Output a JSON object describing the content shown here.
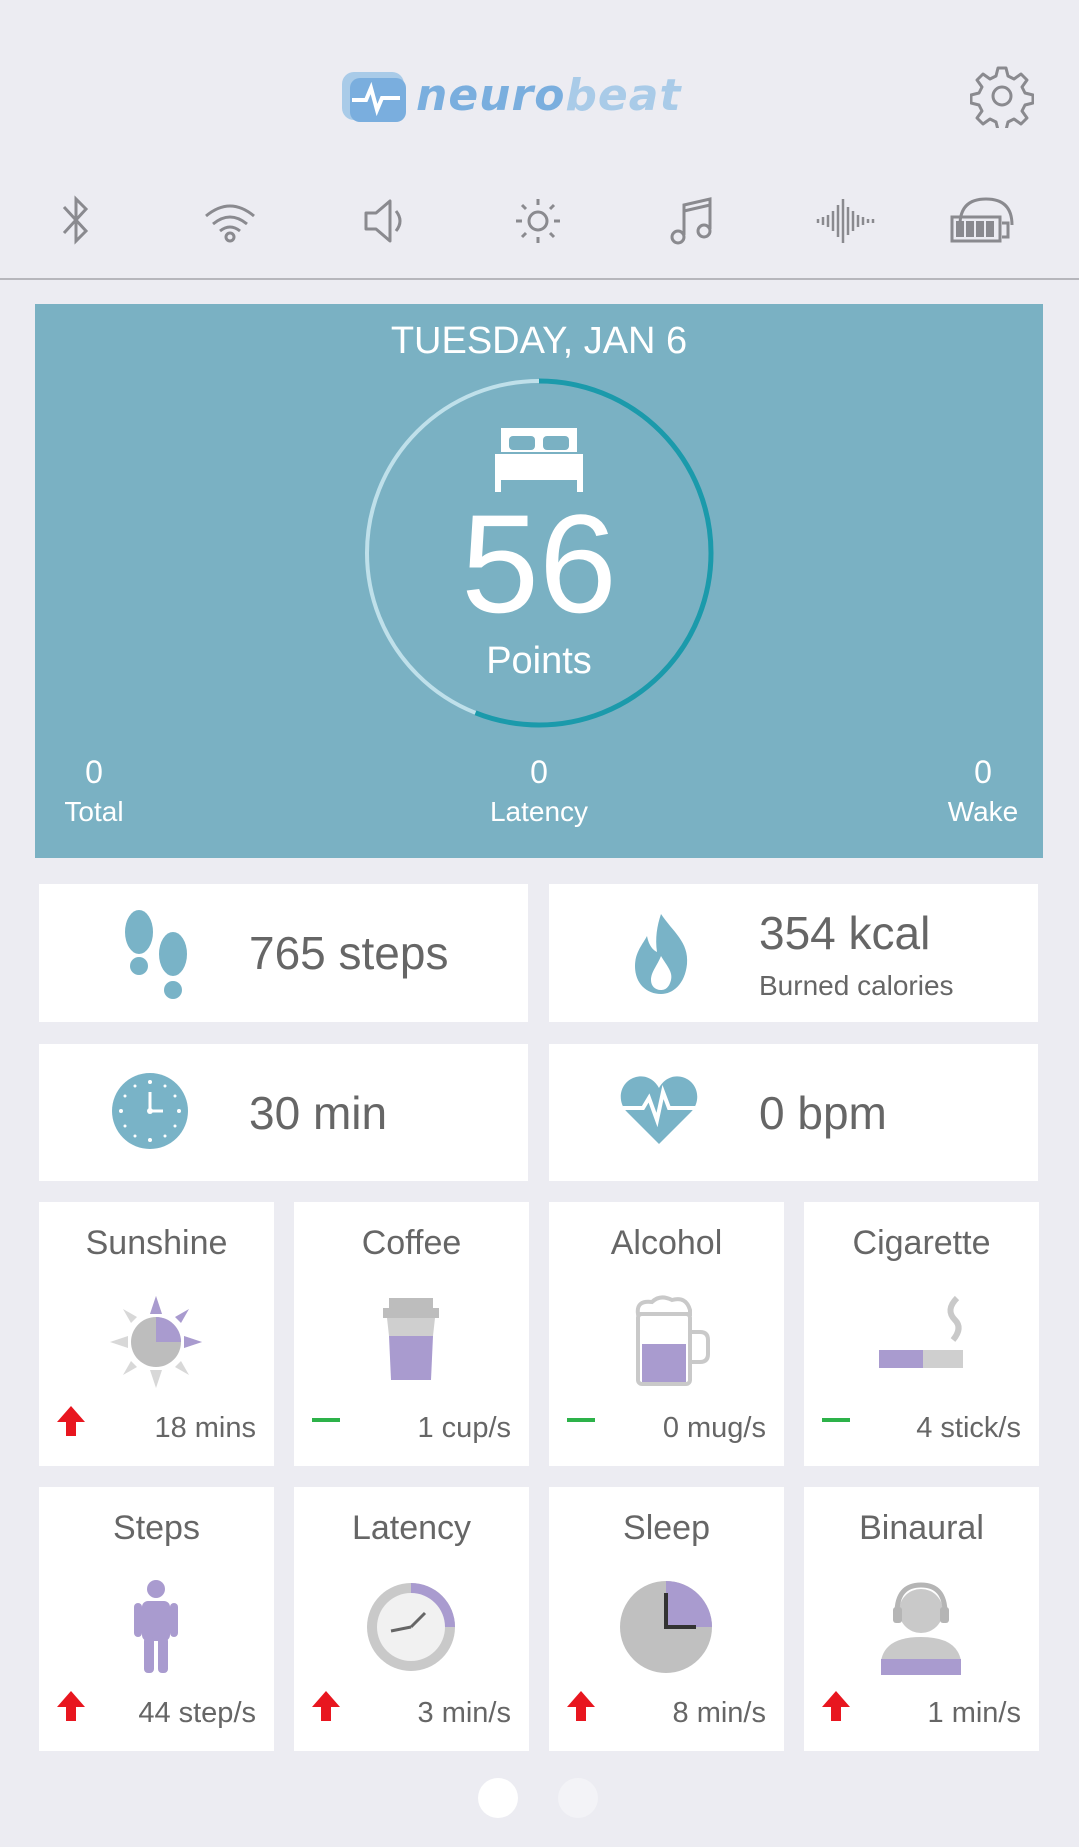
{
  "header": {
    "logo_part_a": "neuro",
    "logo_part_b": "beat",
    "status_icons": [
      "bluetooth-icon",
      "wifi-icon",
      "volume-icon",
      "brightness-icon",
      "music-icon",
      "soundwave-icon",
      "headset-battery-icon"
    ]
  },
  "sleep": {
    "date": "TUESDAY, JAN 6",
    "score": "56",
    "score_unit": "Points",
    "score_progress": 0.56,
    "stats": [
      {
        "value": "0",
        "label": "Total"
      },
      {
        "value": "0",
        "label": "Latency"
      },
      {
        "value": "0",
        "label": "Wake"
      }
    ]
  },
  "metrics": {
    "steps": {
      "value": "765 steps"
    },
    "calories": {
      "value": "354 kcal",
      "sub": "Burned calories"
    },
    "duration": {
      "value": "30 min"
    },
    "heart": {
      "value": "0 bpm"
    }
  },
  "factors": [
    {
      "title": "Sunshine",
      "value": "18 mins",
      "trend": "up"
    },
    {
      "title": "Coffee",
      "value": "1 cup/s",
      "trend": "flat"
    },
    {
      "title": "Alcohol",
      "value": "0 mug/s",
      "trend": "flat"
    },
    {
      "title": "Cigarette",
      "value": "4 stick/s",
      "trend": "flat"
    }
  ],
  "factors2": [
    {
      "title": "Steps",
      "value": "44 step/s",
      "trend": "up"
    },
    {
      "title": "Latency",
      "value": "3 min/s",
      "trend": "up"
    },
    {
      "title": "Sleep",
      "value": "8 min/s",
      "trend": "up"
    },
    {
      "title": "Binaural",
      "value": "1 min/s",
      "trend": "up"
    }
  ],
  "colors": {
    "panel": "#7ab1c3",
    "ring": "#1b9aab",
    "accent_purple": "#a99bcf",
    "trend_up": "#e8161f",
    "trend_flat": "#2db24a"
  },
  "pager": {
    "pages": 2,
    "current": 1
  }
}
